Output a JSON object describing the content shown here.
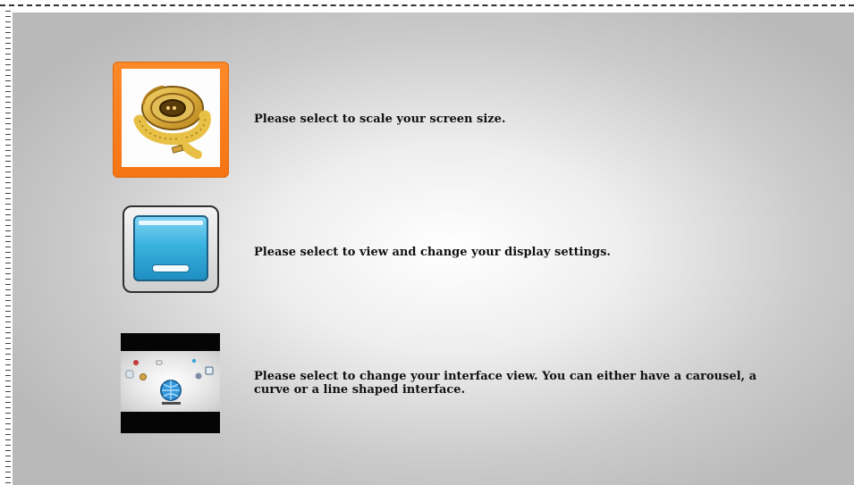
{
  "settings_screen": {
    "options": [
      {
        "id": "scale-screen",
        "icon": "tape-measure-icon",
        "text": "Please select to scale your screen size.",
        "tile_color": "#f57413"
      },
      {
        "id": "display-settings",
        "icon": "display-settings-icon",
        "text": "Please select to view and change your display settings.",
        "tile_color": "#3ab2df"
      },
      {
        "id": "interface-view",
        "icon": "interface-view-icon",
        "text": "Please select to change your interface view. You can either have a carousel, a\ncurve or a line shaped interface."
      }
    ]
  }
}
